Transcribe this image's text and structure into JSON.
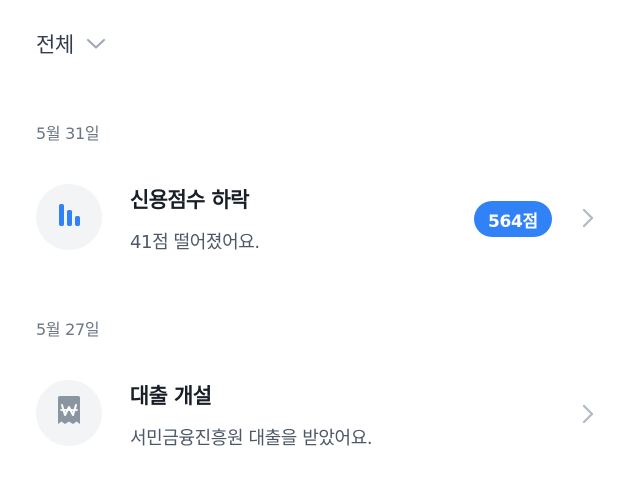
{
  "filter": {
    "label": "전체",
    "icon": "chevron-down-icon"
  },
  "groups": [
    {
      "date": "5월 31일",
      "items": [
        {
          "icon": "bar-chart-icon",
          "title": "신용점수 하락",
          "subtitle": "41점 떨어졌어요.",
          "badge": "564점"
        }
      ]
    },
    {
      "date": "5월 27일",
      "items": [
        {
          "icon": "won-receipt-icon",
          "title": "대출 개설",
          "subtitle": "서민금융진흥원 대출을 받았어요."
        }
      ]
    }
  ],
  "colors": {
    "accent": "#3182f6",
    "icon_gray": "#a0aab6",
    "avatar_bg": "#f2f4f6",
    "chevron": "#b0b8c1"
  }
}
